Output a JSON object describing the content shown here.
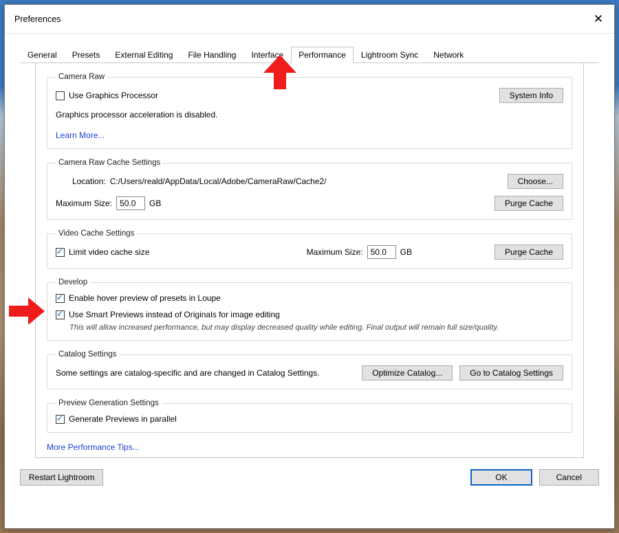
{
  "window": {
    "title": "Preferences",
    "close_icon_glyph": "✕"
  },
  "tabs": {
    "items": [
      {
        "label": "General"
      },
      {
        "label": "Presets"
      },
      {
        "label": "External Editing"
      },
      {
        "label": "File Handling"
      },
      {
        "label": "Interface"
      },
      {
        "label": "Performance"
      },
      {
        "label": "Lightroom Sync"
      },
      {
        "label": "Network"
      }
    ],
    "active_index": 5
  },
  "camera_raw": {
    "legend": "Camera Raw",
    "use_gpu_label": "Use Graphics Processor",
    "use_gpu_checked": false,
    "status_text": "Graphics processor acceleration is disabled.",
    "learn_more": "Learn More...",
    "system_info_btn": "System Info"
  },
  "cache": {
    "legend": "Camera Raw Cache Settings",
    "location_label": "Location:",
    "location_value": "C:/Users/reald/AppData/Local/Adobe/CameraRaw/Cache2/",
    "choose_btn": "Choose...",
    "max_size_label": "Maximum Size:",
    "max_size_value": "50.0",
    "gb": "GB",
    "purge_btn": "Purge Cache"
  },
  "video_cache": {
    "legend": "Video Cache Settings",
    "limit_label": "Limit video cache size",
    "limit_checked": true,
    "max_size_label": "Maximum Size:",
    "max_size_value": "50.0",
    "gb": "GB",
    "purge_btn": "Purge Cache"
  },
  "develop": {
    "legend": "Develop",
    "hover_preview_label": "Enable hover preview of presets in Loupe",
    "hover_preview_checked": true,
    "smart_previews_label": "Use Smart Previews instead of Originals for image editing",
    "smart_previews_checked": true,
    "hint": "This will allow increased performance, but may display decreased quality while editing. Final output will remain full size/quality."
  },
  "catalog": {
    "legend": "Catalog Settings",
    "text": "Some settings are catalog-specific and are changed in Catalog Settings.",
    "optimize_btn": "Optimize Catalog...",
    "goto_btn": "Go to Catalog Settings"
  },
  "preview_gen": {
    "legend": "Preview Generation Settings",
    "parallel_label": "Generate Previews in parallel",
    "parallel_checked": true
  },
  "more_tips": "More Performance Tips...",
  "footer": {
    "restart_btn": "Restart Lightroom",
    "ok_btn": "OK",
    "cancel_btn": "Cancel"
  }
}
